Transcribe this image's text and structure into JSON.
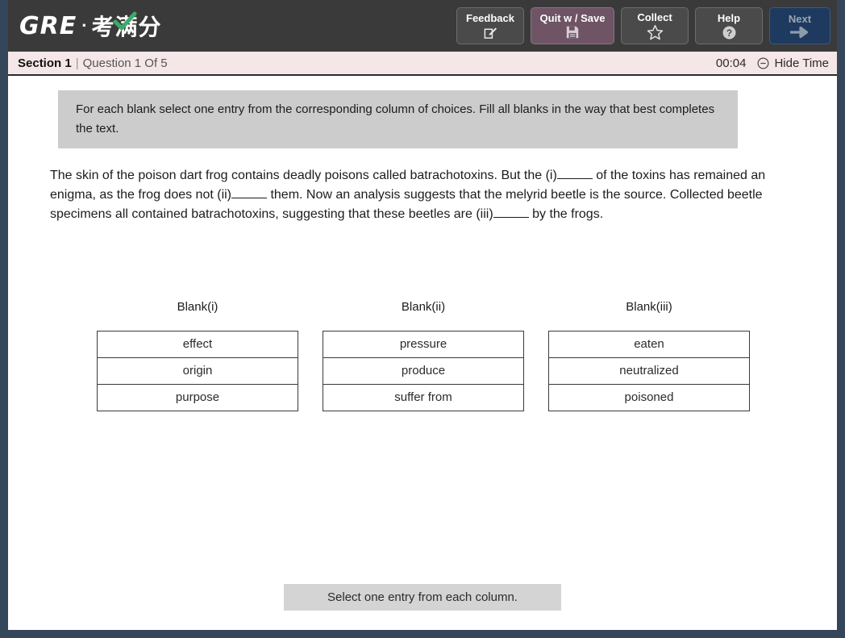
{
  "brand": {
    "gre": "GRE",
    "dot": "·",
    "cn": "考满分",
    "check_color": "#3bab6d"
  },
  "toolbar": {
    "buttons": [
      {
        "label": "Feedback",
        "icon": "edit-square-icon"
      },
      {
        "label": "Quit w / Save",
        "icon": "save-disk-icon"
      },
      {
        "label": "Collect",
        "icon": "star-icon"
      },
      {
        "label": "Help",
        "icon": "question-circle-icon"
      },
      {
        "label": "Next",
        "icon": "arrow-right-icon"
      }
    ],
    "colors": {
      "bar": "#3a3a3a",
      "default_button": "#4a4a4a",
      "quit_button": "#6e5464",
      "next_button": "#1e3a5e"
    }
  },
  "section_bar": {
    "section": "Section 1",
    "separator": "|",
    "question": "Question 1 Of 5",
    "timer": "00:04",
    "hide_time_label": "Hide Time",
    "hide_time_icon": "minus-circle-icon",
    "background": "#f5e7e7"
  },
  "directions": {
    "text": "For each blank select one entry from the corresponding column of choices. Fill all blanks in the way that best completes the text."
  },
  "passage": {
    "part1": "The skin of the poison dart frog contains deadly poisons called batrachotoxins. But the (i)",
    "part2": " of the toxins has remained an enigma, as the frog does not (ii)",
    "part3": " them. Now an analysis suggests that the melyrid beetle is the source. Collected beetle specimens all contained batrachotoxins, suggesting that these beetles are (iii)",
    "part4": " by the frogs."
  },
  "columns": [
    {
      "title": "Blank(i)",
      "options": [
        "effect",
        "origin",
        "purpose"
      ]
    },
    {
      "title": "Blank(ii)",
      "options": [
        "pressure",
        "produce",
        "suffer from"
      ]
    },
    {
      "title": "Blank(iii)",
      "options": [
        "eaten",
        "neutralized",
        "poisoned"
      ]
    }
  ],
  "footer": {
    "note": "Select one entry from each column."
  }
}
